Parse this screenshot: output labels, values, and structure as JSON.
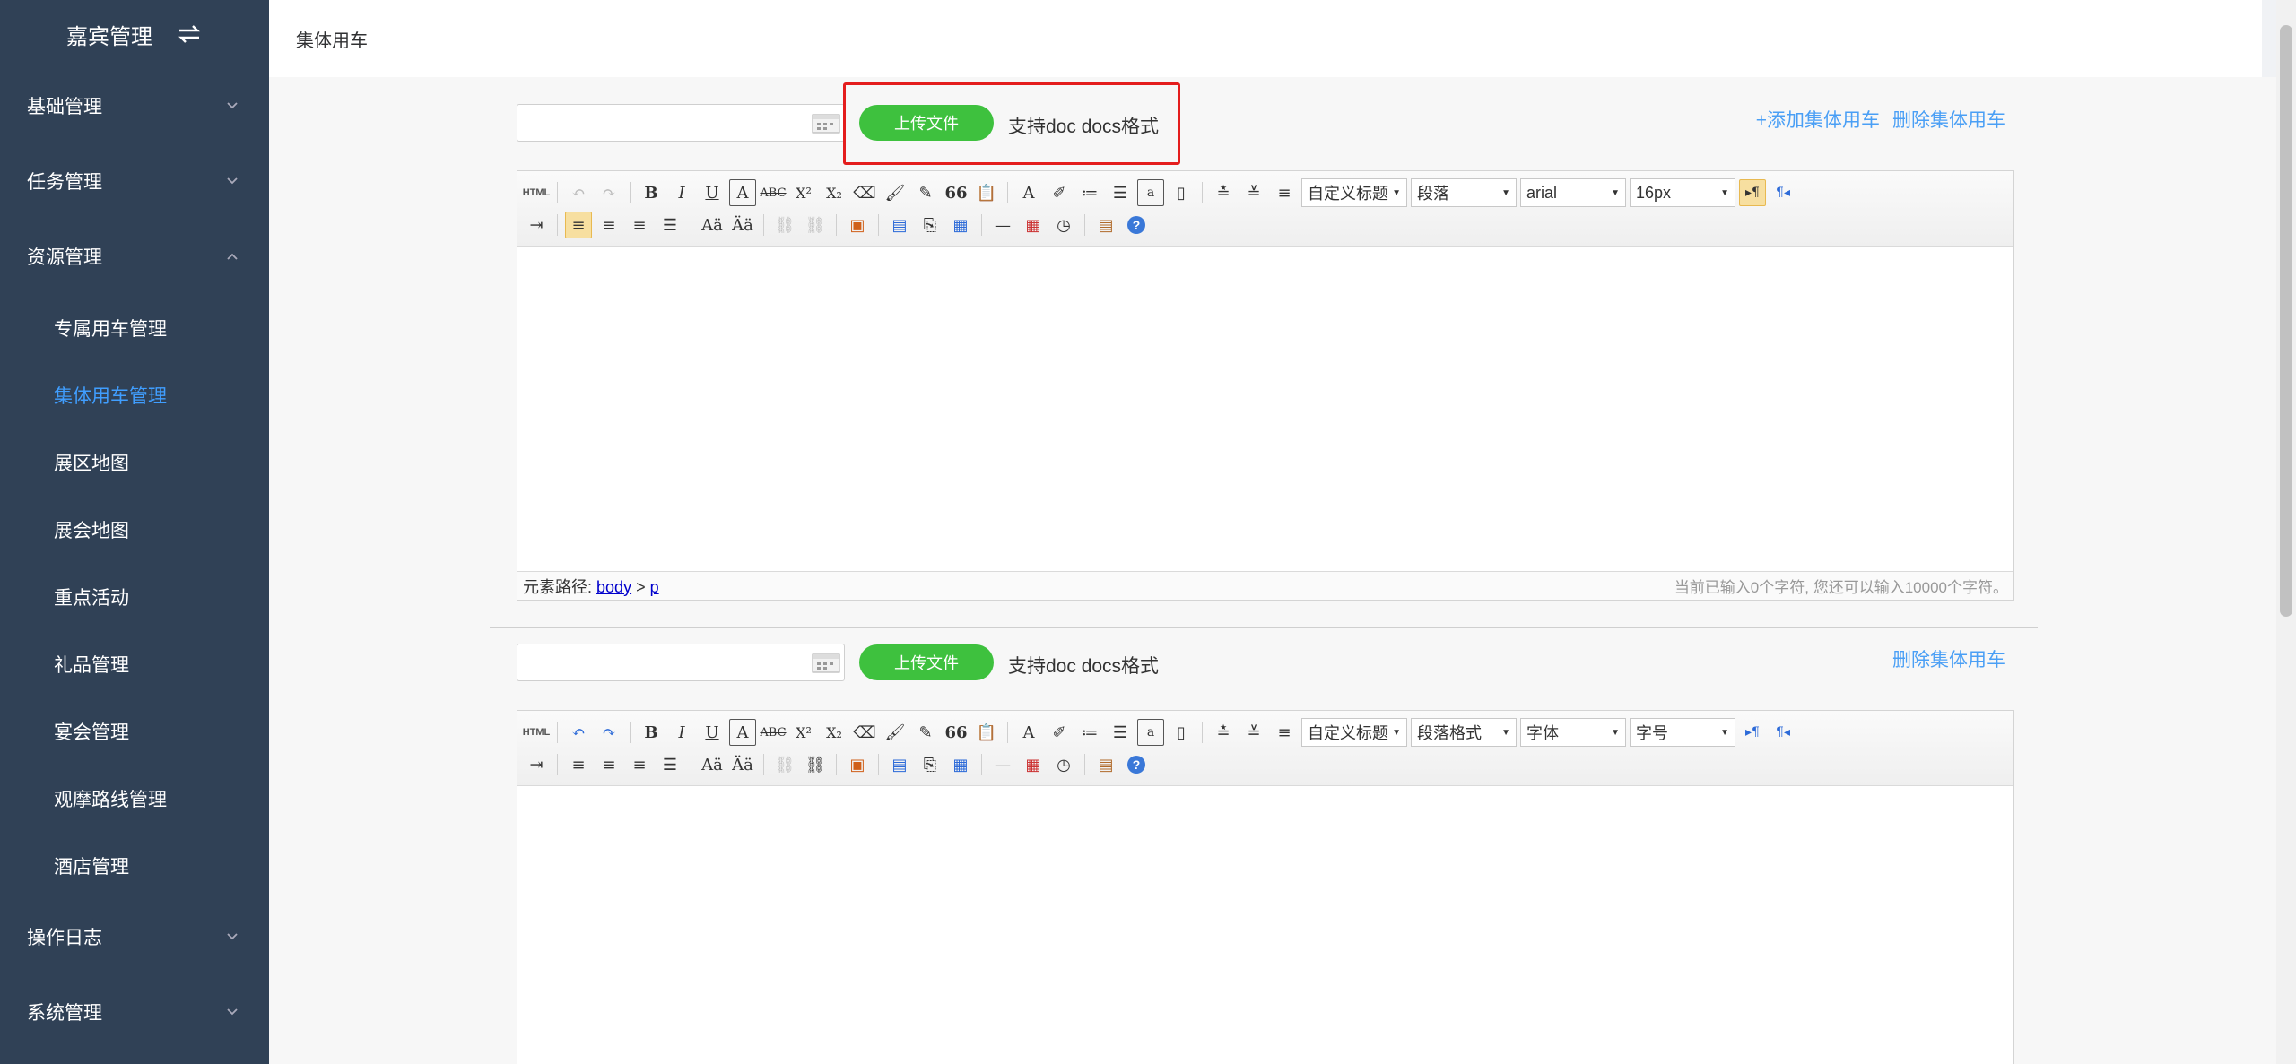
{
  "sidebar": {
    "title": "嘉宾管理",
    "menu": [
      {
        "label": "基础管理"
      },
      {
        "label": "任务管理"
      },
      {
        "label": "资源管理"
      }
    ],
    "submenu": [
      {
        "label": "专属用车管理"
      },
      {
        "label": "集体用车管理"
      },
      {
        "label": "展区地图"
      },
      {
        "label": "展会地图"
      },
      {
        "label": "重点活动"
      },
      {
        "label": "礼品管理"
      },
      {
        "label": "宴会管理"
      },
      {
        "label": "观摩路线管理"
      },
      {
        "label": "酒店管理"
      }
    ],
    "bottom_menu": [
      {
        "label": "操作日志"
      },
      {
        "label": "系统管理"
      }
    ],
    "active_submenu": "集体用车管理"
  },
  "header": {
    "breadcrumb": "集体用车"
  },
  "section1": {
    "upload_label": "上传文件",
    "format_hint": "支持doc docs格式",
    "add_link": "+添加集体用车",
    "delete_link": "删除集体用车",
    "toolbar": {
      "custom_title": "自定义标题",
      "paragraph": "段落",
      "font": "arial",
      "size": "16px"
    },
    "status": {
      "path_label": "元素路径:",
      "path_body": "body",
      "path_sep": ">",
      "path_p": "p",
      "count": "当前已输入0个字符, 您还可以输入10000个字符。"
    }
  },
  "section2": {
    "upload_label": "上传文件",
    "format_hint": "支持doc docs格式",
    "delete_link": "删除集体用车",
    "toolbar": {
      "custom_title": "自定义标题",
      "paragraph": "段落格式",
      "font": "字体",
      "size": "字号"
    }
  },
  "toolbar_glyphs": {
    "html": "HTML",
    "bold": "B",
    "italic": "I",
    "underline": "U",
    "fontborder": "A",
    "strike": "ABC",
    "sup": "X²",
    "sub": "X₂",
    "quote": "66",
    "forecolor": "A",
    "help": "?",
    "hr": "—",
    "ltr": "▸¶",
    "rtl": "¶◂"
  },
  "colors": {
    "sidebar_bg": "#304156",
    "active": "#409eff",
    "upload_btn": "#3ec13e",
    "link": "#4a9ff5",
    "highlight": "#e41d1d"
  }
}
